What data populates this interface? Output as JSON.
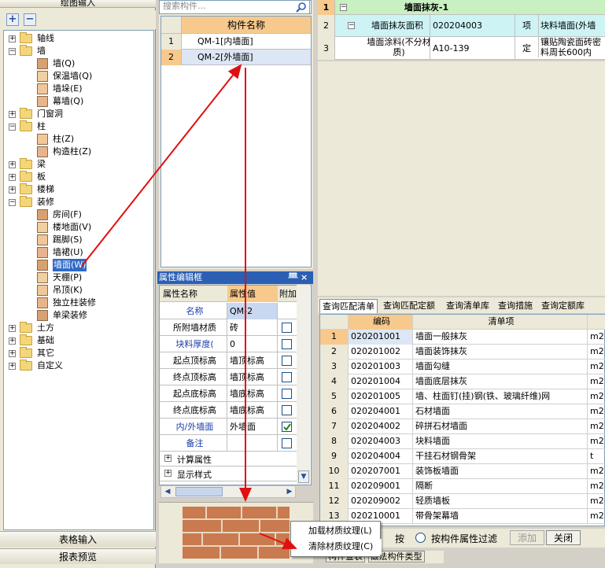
{
  "left_panel": {
    "header": "绘图输入",
    "add_label": "+",
    "remove_label": "−",
    "tree": [
      {
        "label": "轴线",
        "level": 0,
        "type": "folder",
        "expander": "+"
      },
      {
        "label": "墙",
        "level": 0,
        "type": "folder",
        "expander": "−"
      },
      {
        "label": "墙(Q)",
        "level": 1,
        "type": "icon"
      },
      {
        "label": "保温墙(Q)",
        "level": 1,
        "type": "icon"
      },
      {
        "label": "墙垛(E)",
        "level": 1,
        "type": "icon"
      },
      {
        "label": "幕墙(Q)",
        "level": 1,
        "type": "icon"
      },
      {
        "label": "门窗洞",
        "level": 0,
        "type": "folder",
        "expander": "+"
      },
      {
        "label": "柱",
        "level": 0,
        "type": "folder",
        "expander": "−"
      },
      {
        "label": "柱(Z)",
        "level": 1,
        "type": "icon"
      },
      {
        "label": "构造柱(Z)",
        "level": 1,
        "type": "icon"
      },
      {
        "label": "梁",
        "level": 0,
        "type": "folder",
        "expander": "+"
      },
      {
        "label": "板",
        "level": 0,
        "type": "folder",
        "expander": "+"
      },
      {
        "label": "楼梯",
        "level": 0,
        "type": "folder",
        "expander": "+"
      },
      {
        "label": "装修",
        "level": 0,
        "type": "folder",
        "expander": "−"
      },
      {
        "label": "房间(F)",
        "level": 1,
        "type": "icon"
      },
      {
        "label": "楼地面(V)",
        "level": 1,
        "type": "icon"
      },
      {
        "label": "踢脚(S)",
        "level": 1,
        "type": "icon"
      },
      {
        "label": "墙裙(U)",
        "level": 1,
        "type": "icon"
      },
      {
        "label": "墙面(W)",
        "level": 1,
        "type": "icon"
      },
      {
        "label": "天棚(P)",
        "level": 1,
        "type": "icon"
      },
      {
        "label": "吊顶(K)",
        "level": 1,
        "type": "icon"
      },
      {
        "label": "独立柱装修",
        "level": 1,
        "type": "icon"
      },
      {
        "label": "单梁装修",
        "level": 1,
        "type": "icon"
      },
      {
        "label": "土方",
        "level": 0,
        "type": "folder",
        "expander": "+"
      },
      {
        "label": "基础",
        "level": 0,
        "type": "folder",
        "expander": "+"
      },
      {
        "label": "其它",
        "level": 0,
        "type": "folder",
        "expander": "+"
      },
      {
        "label": "自定义",
        "level": 0,
        "type": "folder",
        "expander": "+"
      }
    ],
    "btn_table_input": "表格输入",
    "btn_report_preview": "报表预览"
  },
  "component_list": {
    "search_placeholder": "搜索构件...",
    "header": "构件名称",
    "rows": [
      {
        "num": "1",
        "name": "QM-1[内墙面]"
      },
      {
        "num": "2",
        "name": "QM-2[外墙面]"
      }
    ]
  },
  "properties": {
    "title": "属性编辑框",
    "pin": "ᚙ",
    "close": "×",
    "col_name": "属性名称",
    "col_value": "属性值",
    "col_extra": "附加",
    "rows": [
      {
        "name": "名称",
        "value": "QM-2",
        "checkbox": false,
        "has_checkbox": false,
        "blue": true
      },
      {
        "name": "所附墙材质",
        "value": "砖",
        "checkbox": false,
        "has_checkbox": true,
        "blue": false
      },
      {
        "name": "块料厚度(",
        "value": "0",
        "checkbox": false,
        "has_checkbox": true,
        "blue": true
      },
      {
        "name": "起点顶标高",
        "value": "墙顶标高",
        "checkbox": false,
        "has_checkbox": true,
        "blue": false
      },
      {
        "name": "终点顶标高",
        "value": "墙顶标高",
        "checkbox": false,
        "has_checkbox": true,
        "blue": false
      },
      {
        "name": "起点底标高",
        "value": "墙底标高",
        "checkbox": false,
        "has_checkbox": true,
        "blue": false
      },
      {
        "name": "终点底标高",
        "value": "墙底标高",
        "checkbox": false,
        "has_checkbox": true,
        "blue": false
      },
      {
        "name": "内/外墙面",
        "value": "外墙面",
        "checkbox": true,
        "has_checkbox": true,
        "blue": true
      },
      {
        "name": "备注",
        "value": "",
        "checkbox": false,
        "has_checkbox": true,
        "blue": true
      }
    ],
    "groups": [
      "计算属性",
      "显示样式"
    ],
    "group_expander": "+"
  },
  "context_menu": {
    "items": [
      "加载材质纹理(L)",
      "清除材质纹理(C)"
    ]
  },
  "bottom_tabs": {
    "items": [
      "构件查表",
      "做法构件类型"
    ]
  },
  "top_right": {
    "rows": [
      {
        "num": "1",
        "expander": "−",
        "name": "墙面抹灰-1",
        "code": "",
        "type": "",
        "desc": ""
      },
      {
        "num": "2",
        "expander": "−",
        "name": "墙面抹灰面积",
        "code": "020204003",
        "type": "项",
        "desc": "块料墙面(外墙"
      },
      {
        "num": "3",
        "expander": "",
        "name": "墙面涂料(不分材质)",
        "code": "A10-139",
        "type": "定",
        "desc": "镶贴陶瓷面砖密 料周长600内"
      }
    ]
  },
  "query": {
    "tabs": [
      "查询匹配清单",
      "查询匹配定额",
      "查询清单库",
      "查询措施",
      "查询定额库"
    ],
    "col_code": "编码",
    "col_item": "清单项",
    "rows": [
      {
        "num": "1",
        "code": "020201001",
        "item": "墙面一般抹灰",
        "unit": "m2"
      },
      {
        "num": "2",
        "code": "020201002",
        "item": "墙面装饰抹灰",
        "unit": "m2"
      },
      {
        "num": "3",
        "code": "020201003",
        "item": "墙面勾缝",
        "unit": "m2"
      },
      {
        "num": "4",
        "code": "020201004",
        "item": "墙面底层抹灰",
        "unit": "m2"
      },
      {
        "num": "5",
        "code": "020201005",
        "item": "墙、柱面钉(挂)钢(铁、玻璃纤维)网",
        "unit": "m2"
      },
      {
        "num": "6",
        "code": "020204001",
        "item": "石材墙面",
        "unit": "m2"
      },
      {
        "num": "7",
        "code": "020204002",
        "item": "碎拼石材墙面",
        "unit": "m2"
      },
      {
        "num": "8",
        "code": "020204003",
        "item": "块料墙面",
        "unit": "m2"
      },
      {
        "num": "9",
        "code": "020204004",
        "item": "干挂石材钢骨架",
        "unit": "t"
      },
      {
        "num": "10",
        "code": "020207001",
        "item": "装饰板墙面",
        "unit": "m2"
      },
      {
        "num": "11",
        "code": "020209001",
        "item": "隔断",
        "unit": "m2"
      },
      {
        "num": "12",
        "code": "020209002",
        "item": "轻质墙板",
        "unit": "m2"
      },
      {
        "num": "13",
        "code": "020210001",
        "item": "带骨架幕墙",
        "unit": "m2"
      }
    ],
    "bar": {
      "radio_a": "按",
      "radio_b": "按构件属性过滤",
      "add": "添加",
      "close": "关闭"
    }
  },
  "colors": {
    "accent": "#2a5fb4",
    "highlight_row": "#f7c98d",
    "arrow": "#e01010",
    "green_row": "#c8f0c0"
  }
}
